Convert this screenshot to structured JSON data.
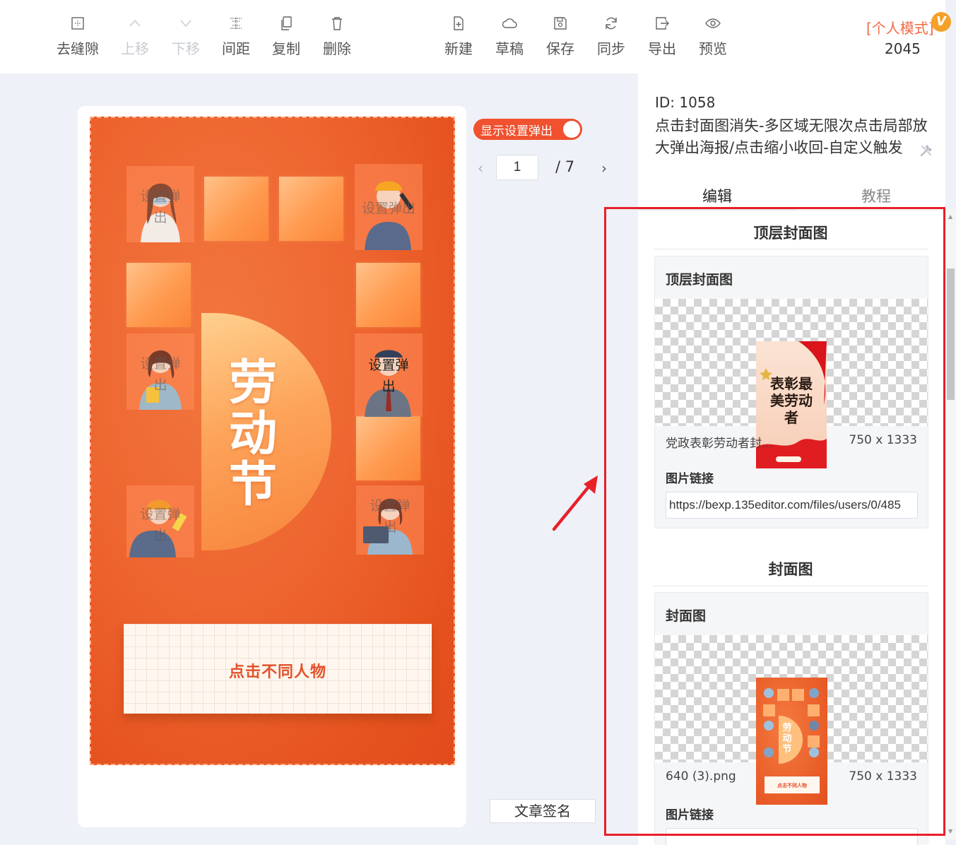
{
  "toolbar": {
    "left_buttons": [
      {
        "label": "去缝隙",
        "icon": "remove-gap-icon"
      },
      {
        "label": "上移",
        "icon": "arrow-up-icon"
      },
      {
        "label": "下移",
        "icon": "arrow-down-icon"
      },
      {
        "label": "间距",
        "icon": "spacing-icon"
      },
      {
        "label": "复制",
        "icon": "copy-icon"
      },
      {
        "label": "删除",
        "icon": "trash-icon"
      }
    ],
    "right_buttons": [
      {
        "label": "新建",
        "icon": "new-file-icon"
      },
      {
        "label": "草稿",
        "icon": "cloud-icon"
      },
      {
        "label": "保存",
        "icon": "save-icon"
      },
      {
        "label": "同步",
        "icon": "sync-icon"
      },
      {
        "label": "导出",
        "icon": "export-icon"
      },
      {
        "label": "预览",
        "icon": "eye-icon"
      }
    ],
    "mode_label": "[个人模式]",
    "mode_badge": "V",
    "mode_number": "2045"
  },
  "poster": {
    "popup_label": "设置弹出",
    "popup_label_split": [
      "设置弹",
      "出"
    ],
    "title": "劳动节",
    "cta": "点击不同人物"
  },
  "controls": {
    "popup_toggle_label": "显示设置弹出",
    "page_current": "1",
    "page_total": "/ 7",
    "prev": "‹",
    "next": "›",
    "signature_button": "文章签名"
  },
  "panel": {
    "id_text": "ID: 1058",
    "title": "点击封面图消失-多区域无限次点击局部放大弹出海报/点击缩小收回-自定义触发",
    "tabs": [
      "编辑",
      "教程"
    ],
    "sections": [
      {
        "heading": "顶层封面图",
        "card_title": "顶层封面图",
        "file_name": "党政表彰劳动者封…",
        "file_size": "750 x 1333",
        "link_label": "图片链接",
        "link_value": "https://bexp.135editor.com/files/users/0/485"
      },
      {
        "heading": "封面图",
        "card_title": "封面图",
        "file_name": "640 (3).png",
        "file_size": "750 x 1333",
        "link_label": "图片链接"
      }
    ],
    "thumb1_text": "表彰最美劳动者",
    "thumb2_title": "劳动节",
    "thumb2_cta": "点击不同人物"
  },
  "colors": {
    "accent": "#f0512f",
    "annotation": "#e8202a",
    "poster_bg": "#e95a23"
  }
}
